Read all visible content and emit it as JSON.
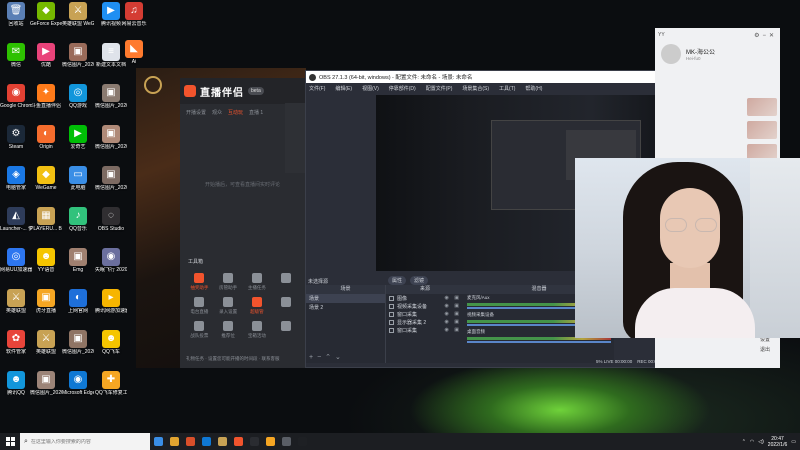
{
  "desktop": {
    "icons": [
      {
        "label": "回收站",
        "glyph": "🗑",
        "color": "#5a7fb5"
      },
      {
        "label": "GeForce Experience",
        "glyph": "◆",
        "color": "#76b900"
      },
      {
        "label": "英雄联盟 WeGame版",
        "glyph": "⚔",
        "color": "#c8a254"
      },
      {
        "label": "腾讯视频",
        "glyph": "▶",
        "color": "#1f8ff2"
      },
      {
        "label": "网易云音乐",
        "glyph": "♫",
        "color": "#d43c33"
      },
      {
        "label": "优酷",
        "glyph": "▶",
        "color": "#e9437a"
      },
      {
        "label": "微信",
        "glyph": "✉",
        "color": "#2dc100"
      },
      {
        "label": "微信图片_2020091...",
        "glyph": "▣",
        "color": "#9a6b5a"
      },
      {
        "label": "新建文本文档",
        "glyph": "≡",
        "color": "#dfe3ea"
      },
      {
        "label": "Ai",
        "glyph": "◣",
        "color": "#ff7a2e"
      },
      {
        "label": "Google Chrome",
        "glyph": "◉",
        "color": "#e34133"
      },
      {
        "label": "斗鱼直播伴侣",
        "glyph": "✦",
        "color": "#ff7b1a"
      },
      {
        "label": "QQ游戏",
        "glyph": "◎",
        "color": "#1296db"
      },
      {
        "label": "微信图片_2020090...",
        "glyph": "▣",
        "color": "#8a7a70"
      },
      {
        "label": "Steam",
        "glyph": "⚙",
        "color": "#1b2838"
      },
      {
        "label": "Origin",
        "glyph": "◐",
        "color": "#f56c2d"
      },
      {
        "label": "爱奇艺",
        "glyph": "▶",
        "color": "#00be06"
      },
      {
        "label": "微信图片_2020110...",
        "glyph": "▣",
        "color": "#b08a78"
      },
      {
        "label": "电脑管家",
        "glyph": "◈",
        "color": "#1a78e5"
      },
      {
        "label": "WeGame",
        "glyph": "◆",
        "color": "#f2c012"
      },
      {
        "label": "此电脑",
        "glyph": "▭",
        "color": "#3a8ee6"
      },
      {
        "label": "微信图片_2020121...",
        "glyph": "▣",
        "color": "#7c6a62"
      },
      {
        "label": "Launcher-... 快捷方式",
        "glyph": "◭",
        "color": "#2e3c5a"
      },
      {
        "label": "PLAYERU... BATTLEGR...",
        "glyph": "▦",
        "color": "#c8a254"
      },
      {
        "label": "QQ音乐",
        "glyph": "♪",
        "color": "#31c27c"
      },
      {
        "label": "OBS Studio",
        "glyph": "◌",
        "color": "#302e31"
      },
      {
        "label": "网易UU加速器",
        "glyph": "◎",
        "color": "#2d76f0"
      },
      {
        "label": "YY语音",
        "glyph": "☻",
        "color": "#f5c500"
      },
      {
        "label": "Emg",
        "glyph": "▣",
        "color": "#a08070"
      },
      {
        "label": "失眠飞行 2020083...",
        "glyph": "◉",
        "color": "#6b6f9e"
      },
      {
        "label": "英雄联盟",
        "glyph": "⚔",
        "color": "#c8a254"
      },
      {
        "label": "虎牙直播",
        "glyph": "▣",
        "color": "#f5a623"
      },
      {
        "label": "上网官网",
        "glyph": "◐",
        "color": "#1e6fd9"
      },
      {
        "label": "腾讯网游加速器",
        "glyph": "▸",
        "color": "#f7b500"
      },
      {
        "label": "软件管家",
        "glyph": "✿",
        "color": "#e8443a"
      },
      {
        "label": "英雄联盟",
        "glyph": "⚔",
        "color": "#c8a254"
      },
      {
        "label": "微信图片_2020081...",
        "glyph": "▣",
        "color": "#8f7464"
      },
      {
        "label": "QQ飞车",
        "glyph": "☻",
        "color": "#f5c500"
      },
      {
        "label": "腾讯QQ",
        "glyph": "☻",
        "color": "#1296db"
      },
      {
        "label": "微信图片_2020091...",
        "glyph": "▣",
        "color": "#9c8478"
      },
      {
        "label": "Microsoft Edge",
        "glyph": "◉",
        "color": "#0f78d4"
      },
      {
        "label": "QQ飞车修复工具",
        "glyph": "✚",
        "color": "#f5a623"
      }
    ]
  },
  "live_app": {
    "brand": "直播伴侣",
    "version": "beta",
    "tabs": [
      "开播设置",
      "观众",
      "互动玩",
      "直播 1"
    ],
    "active_tab": "互动玩",
    "empty_note": "开始播后，可查看直播间实时评论",
    "tools_title": "工具箱",
    "tools": [
      {
        "label": "抽奖助手",
        "hot": true
      },
      {
        "label": "房管助手",
        "hot": false
      },
      {
        "label": "主播任务",
        "hot": false
      },
      {
        "label": "",
        "hot": false
      },
      {
        "label": "电台直播",
        "hot": false
      },
      {
        "label": "录入设置",
        "hot": false
      },
      {
        "label": "超级管",
        "hot": true
      },
      {
        "label": "",
        "hot": false
      },
      {
        "label": "战队投票",
        "hot": false
      },
      {
        "label": "推荐位",
        "hot": false
      },
      {
        "label": "宝箱活动",
        "hot": false
      },
      {
        "label": "",
        "hot": false
      }
    ],
    "footer": "礼物任务 · 设置您可能开播的时间段 · 联系客服"
  },
  "obs": {
    "title": "OBS 27.1.3 (64-bit, windows) - 配置文件: 未命名 - 场景: 未命名",
    "menu": [
      "文件(F)",
      "编辑(E)",
      "视图(V)",
      "停靠部件(D)",
      "配置文件(P)",
      "场景集合(S)",
      "工具(T)",
      "帮助(H)"
    ],
    "preview_tools": [
      "属性",
      "滤镜"
    ],
    "scenes_dock_label": "未选择源",
    "scenes_header": "场景",
    "scenes": [
      "场景",
      "场景 2"
    ],
    "sources_header": "来源",
    "sources": [
      "图像",
      "视频采集设备",
      "窗口采集",
      "显示器采集 2",
      "窗口采集"
    ],
    "mixer_header": "混音器",
    "mixer_channels": [
      {
        "name": "麦克风/Aux",
        "level": "0.0 dB"
      },
      {
        "name": "视频采集设备",
        "level": "0.0 dB"
      },
      {
        "name": "桌面音频",
        "level": "-4.2 dB"
      }
    ],
    "status": [
      "5% LIVE 00:00:00",
      "REC 00:00:00",
      "CPU: 2.3%, 60.00 fps"
    ]
  },
  "chat": {
    "top_label": "YY",
    "name": "MK-海公公",
    "sub": "Hei-fu0",
    "btn_a": "设置",
    "btn_b": "退出"
  },
  "taskbar": {
    "search_placeholder": "在这里输入你要搜索的内容",
    "apps": [
      "#3a8ee6",
      "#e2a430",
      "#d94f2a",
      "#0f78d4",
      "#c8a254",
      "#f2542d",
      "#2a2c31",
      "#f5a623",
      "#5a5e66",
      "#1e2024"
    ],
    "time": "20:47",
    "date": "2022/1/6"
  }
}
